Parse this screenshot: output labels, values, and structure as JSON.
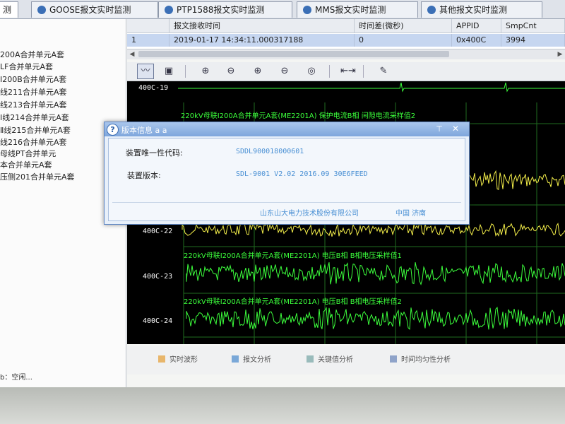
{
  "tabs": [
    {
      "label": "测"
    },
    {
      "label": "GOOSE报文实时监测"
    },
    {
      "label": "PTP1588报文实时监测"
    },
    {
      "label": "MMS报文实时监测"
    },
    {
      "label": "其他报文实时监测"
    }
  ],
  "left_list": {
    "items": [
      "200A合并单元A套",
      "LF合并单元A套",
      "Ⅰ200B合并单元A套",
      "线211合并单元A套",
      "线213合并单元A套",
      "Ⅰ线214合并单元A套",
      "Ⅱ线215合并单元A套",
      "线216合并单元A套",
      "母线PT合并单元",
      "本合并单元A套",
      "压侧201合并单元A套"
    ],
    "status": "b：空闲..."
  },
  "table": {
    "headers": [
      "报文接收时间",
      "时间差(微秒)",
      "APPID",
      "SmpCnt"
    ],
    "rows": [
      {
        "index": "1",
        "time": "2019-01-17 14:34:11.000317188",
        "diff": "0",
        "appid": "0x400C",
        "smpcnt": "3994"
      }
    ]
  },
  "toolbar": {
    "buttons": [
      "waveform-view",
      "image-view",
      "zoom-in",
      "zoom-out",
      "zoom-in-x",
      "zoom-out-x",
      "zoom-reset",
      "fit-range",
      "color-settings"
    ]
  },
  "waveform": {
    "channels": [
      {
        "label": "400C-19",
        "title": "",
        "color": "#3cff3c"
      },
      {
        "label": "400C-22",
        "title": "220kV母联Ⅰ200A合并单元A套(ME2201A) 保护电流B相 间隙电流采样值2",
        "color": "#f5f04a"
      },
      {
        "label": "400C-23",
        "title": "220kV母联Ⅰ200A合并单元A套(ME2201A) 电压B相 B相电压采样值1",
        "color": "#3cff3c"
      },
      {
        "label": "400C-24",
        "title": "220kV母联Ⅰ200A合并单元A套(ME2201A) 电压B相 B相电压采样值2",
        "color": "#3cff3c"
      }
    ]
  },
  "bottom_tabs": [
    "实时波形",
    "报文分析",
    "关键值分析",
    "时间均匀性分析"
  ],
  "dialog": {
    "title": "版本信息",
    "title_suffix": "a a",
    "unique_code_label": "装置唯一性代码:",
    "unique_code_value": "SDDL900018000601",
    "version_label": "装置版本:",
    "version_value": "SDL-9001 V2.02 2016.09 30E6FEED",
    "footer_company": "山东山大电力技术股份有限公司",
    "footer_location": "中国 济南"
  },
  "colors": {
    "accent": "#3b6fb6",
    "selection": "#c6d6f0",
    "wave_bg": "#000000",
    "green_trace": "#3cff3c",
    "yellow_trace": "#f5f04a",
    "dialog_text_blue": "#4a90d4"
  }
}
